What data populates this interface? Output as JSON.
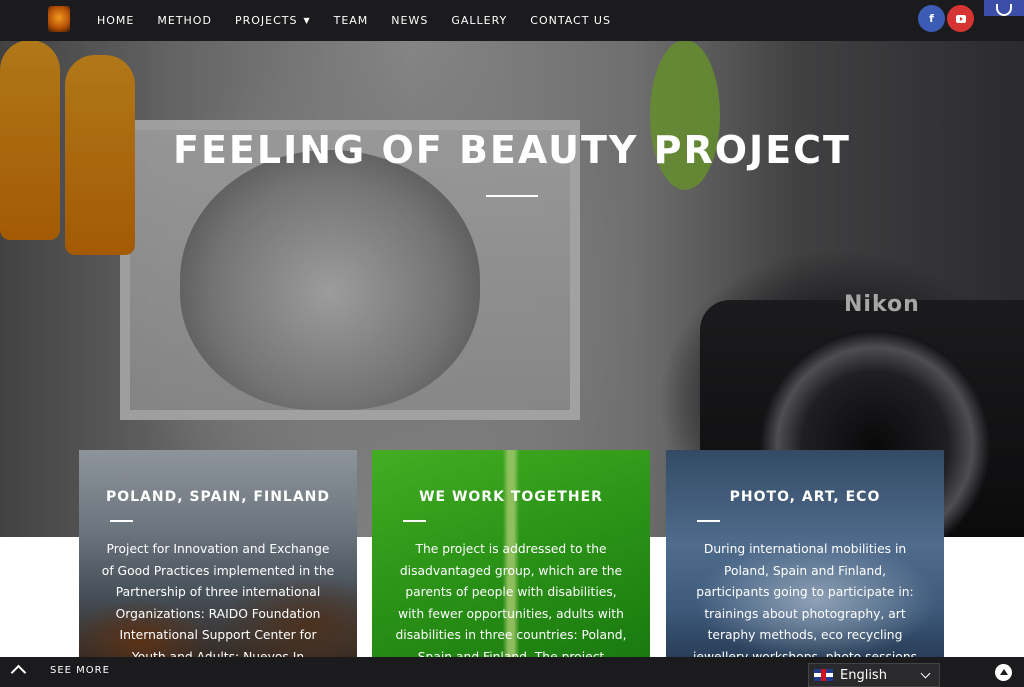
{
  "nav": {
    "items": [
      {
        "label": "HOME"
      },
      {
        "label": "METHOD"
      },
      {
        "label": "PROJECTS"
      },
      {
        "label": "TEAM"
      },
      {
        "label": "NEWS"
      },
      {
        "label": "GALLERY"
      },
      {
        "label": "CONTACT US"
      }
    ],
    "social": [
      {
        "icon": "facebook-icon",
        "glyph": "f",
        "color": "#3b5bb5"
      },
      {
        "icon": "youtube-icon",
        "color": "#d63333"
      }
    ],
    "accessibility_color": "#3b4fa8"
  },
  "hero": {
    "title": "FEELING OF BEAUTY PROJECT",
    "camera_brand": "Nikon"
  },
  "cards": [
    {
      "title": "POLAND, SPAIN, FINLAND",
      "text": "Project for Innovation and Exchange of Good Practices implemented in the Partnership of three international Organizations: RAIDO Foundation International Support Center for Youth and Adults; Nuevos In"
    },
    {
      "title": "WE WORK TOGETHER",
      "text": "The project is addressed to the disadvantaged group, which are the parents of people with disabilities, with fewer opportunities, adults with disabilities in three countries: Poland, Spain and Finland. The project involve"
    },
    {
      "title": "PHOTO, ART, ECO",
      "text": "During international mobilities in Poland, Spain and Finland, participants going to participate in: trainings about photography, art teraphy methods, eco recycling jewellery workshops, photo sessions"
    }
  ],
  "footer": {
    "see_more": "SEE MORE",
    "language": "English"
  }
}
